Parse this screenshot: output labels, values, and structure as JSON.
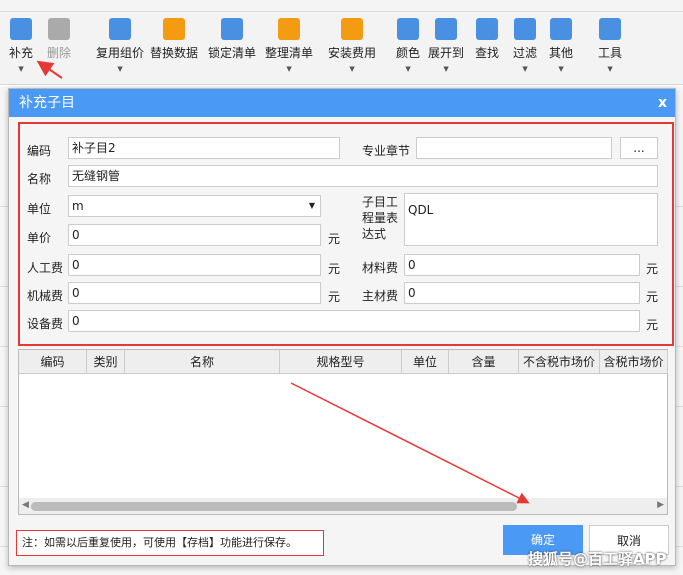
{
  "toolbar": {
    "items": [
      {
        "label": "补充",
        "icon": "add-item-icon",
        "color": "#4a90e2",
        "dropdown": true
      },
      {
        "label": "删除",
        "icon": "trash-icon",
        "color": "#aaaaaa",
        "disabled": true
      },
      {
        "label": "复用组价",
        "icon": "reuse-icon",
        "color": "#4a90e2",
        "dropdown": true
      },
      {
        "label": "替换数据",
        "icon": "replace-icon",
        "color": "#f39c12"
      },
      {
        "label": "锁定清单",
        "icon": "lock-icon",
        "color": "#4a90e2"
      },
      {
        "label": "整理清单",
        "icon": "list-icon",
        "color": "#f39c12",
        "dropdown": true
      },
      {
        "label": "安装费用",
        "icon": "coins-icon",
        "color": "#f39c12",
        "dropdown": true
      },
      {
        "label": "颜色",
        "icon": "paint-bucket-icon",
        "color": "#4a90e2",
        "dropdown": true
      },
      {
        "label": "展开到",
        "icon": "tree-icon",
        "color": "#4a90e2",
        "dropdown": true
      },
      {
        "label": "查找",
        "icon": "binoculars-icon",
        "color": "#4a90e2"
      },
      {
        "label": "过滤",
        "icon": "filter-icon",
        "color": "#4a90e2",
        "dropdown": true
      },
      {
        "label": "其他",
        "icon": "grid-icon",
        "color": "#4a90e2",
        "dropdown": true
      },
      {
        "label": "工具",
        "icon": "tools-icon",
        "color": "#4a90e2",
        "dropdown": true
      }
    ]
  },
  "dialog": {
    "title": "补充子目",
    "close": "x",
    "form": {
      "code_label": "编码",
      "code_value": "补子目2",
      "chapter_label": "专业章节",
      "chapter_value": "",
      "browse_label": "...",
      "name_label": "名称",
      "name_value": "无缝钢管",
      "unit_label": "单位",
      "unit_value": "m",
      "expr_label": "子目工程量表达式",
      "expr_value": "QDL",
      "price_label": "单价",
      "price_value": "0",
      "labor_label": "人工费",
      "labor_value": "0",
      "material_label": "材料费",
      "material_value": "0",
      "machine_label": "机械费",
      "machine_value": "0",
      "main_material_label": "主材费",
      "main_material_value": "0",
      "equipment_label": "设备费",
      "equipment_value": "0",
      "currency": "元"
    },
    "grid": {
      "columns": [
        "编码",
        "类别",
        "名称",
        "规格型号",
        "单位",
        "含量",
        "不含税市场价",
        "含税市场价"
      ]
    },
    "note": "注：如需以后重复使用，可使用【存档】功能进行保存。",
    "ok": "确定",
    "cancel": "取消"
  },
  "watermark": "搜狐号@百工驿APP",
  "accent_color": "#4a9af5"
}
